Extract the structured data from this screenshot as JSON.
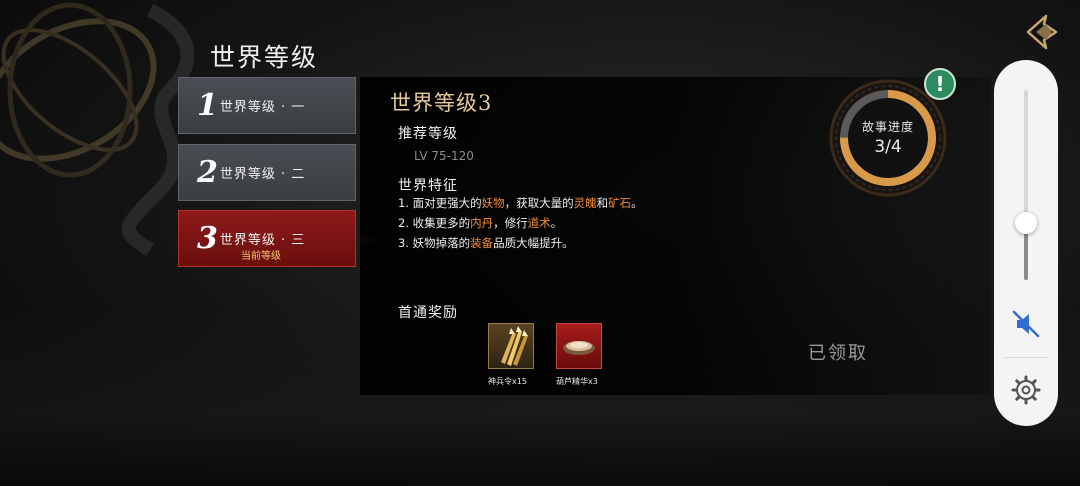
{
  "page_title": "世界等级",
  "tiers": [
    {
      "num": "1",
      "name": "世界等级 · 一"
    },
    {
      "num": "2",
      "name": "世界等级 · 二"
    },
    {
      "num": "3",
      "name": "世界等级 · 三",
      "status": "当前等级"
    }
  ],
  "detail": {
    "title": "世界等级3",
    "recommended_heading": "推荐等级",
    "level_range": "LV 75-120",
    "features_heading": "世界特征",
    "features": [
      {
        "prefix": "1. 面对更强大的",
        "h1": "妖物",
        "mid1": "，获取大量的",
        "h2": "灵魄",
        "mid2": "和",
        "h3": "矿石",
        "suffix": "。"
      },
      {
        "prefix": "2. 收集更多的",
        "h1": "内丹",
        "mid1": "，修行",
        "h2": "道术",
        "suffix": "。"
      },
      {
        "prefix": "3. 妖物掉落的",
        "h1": "装备",
        "suffix": "品质大幅提升。"
      }
    ],
    "rewards_heading": "首通奖励",
    "rewards": [
      {
        "icon": "golden-spears-icon",
        "caption": "神兵令x15"
      },
      {
        "icon": "essence-bowl-icon",
        "caption": "葫芦精华x3"
      }
    ],
    "claimed_label": "已领取"
  },
  "story_progress": {
    "label": "故事进度",
    "value": "3/4",
    "fraction": 0.75,
    "alert": "!"
  },
  "side_panel": {
    "volume_level": 0.3,
    "mute_icon": "mute-speaker-icon",
    "settings_icon": "gear-icon"
  },
  "colors": {
    "accent_gold": "#e7c89a",
    "highlight_orange": "#f08a34",
    "active_tab_red": "#8e1a1a",
    "progress_ring": "#d89a48",
    "alert_green": "#2e8b5e"
  }
}
